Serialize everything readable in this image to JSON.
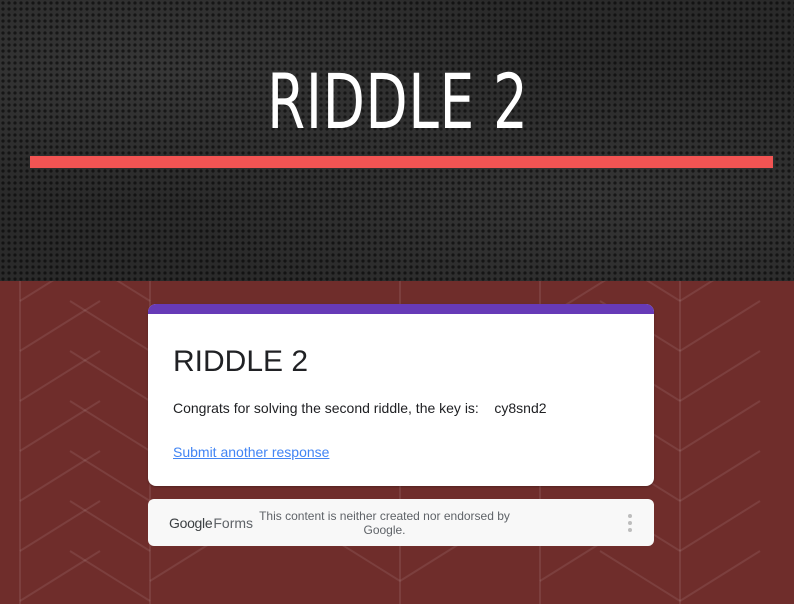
{
  "banner": {
    "title": "RIDDLE 2"
  },
  "form": {
    "title": "RIDDLE 2",
    "message": "Congrats for solving the second riddle, the key is:    cy8snd2",
    "submit_another_label": "Submit another response"
  },
  "footer": {
    "logo_google": "Google",
    "logo_forms": "Forms",
    "disclaimer": "This content is neither created nor endorsed by Google.",
    "menu_icon": "more-vert-icon"
  },
  "colors": {
    "banner_bg": "#2a2a2a",
    "banner_rule": "#f25453",
    "page_bg": "#6f2d2b",
    "card_accent": "#673ab7",
    "link": "#4285f4"
  }
}
